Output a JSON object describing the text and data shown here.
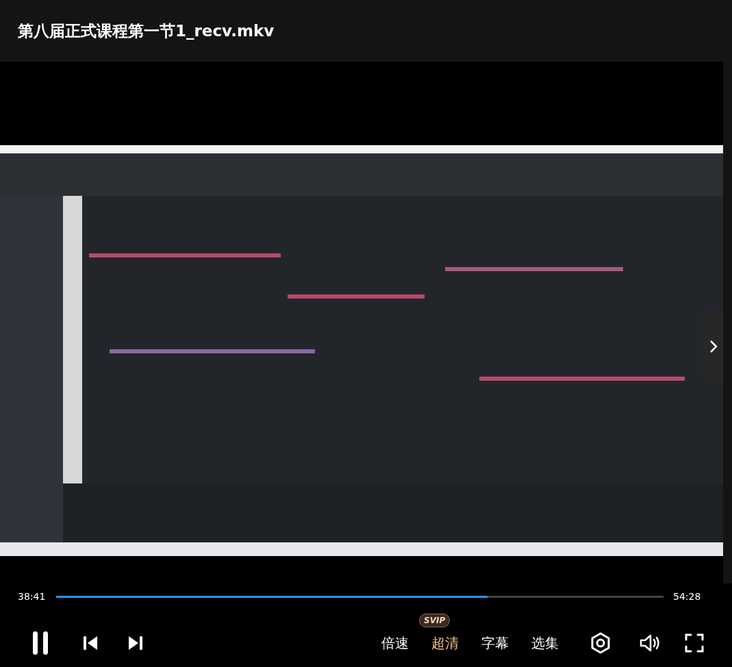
{
  "title": "第八届正式课程第一节1_recv.mkv",
  "player": {
    "current_time": "38:41",
    "duration": "54:28",
    "progress": {
      "level": 0.71
    },
    "playing": true
  },
  "options": [
    {
      "label": "倍速",
      "selected": false
    },
    {
      "label": "超清",
      "selected": true,
      "badge": "SVIP"
    },
    {
      "label": "字幕",
      "selected": false
    },
    {
      "label": "选集",
      "selected": false
    }
  ]
}
